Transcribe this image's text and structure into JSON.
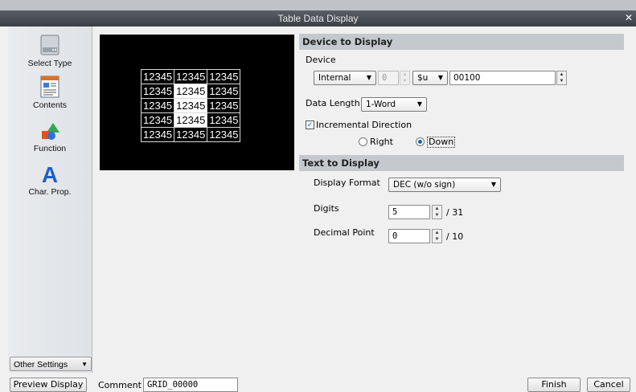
{
  "window": {
    "title": "Table Data Display"
  },
  "sidebar": {
    "items": [
      {
        "label": "Select Type",
        "icon": "select-type-icon"
      },
      {
        "label": "Contents",
        "icon": "contents-icon"
      },
      {
        "label": "Function",
        "icon": "function-icon"
      },
      {
        "label": "Char. Prop.",
        "icon": "char-prop-icon"
      }
    ],
    "other_settings": "Other Settings"
  },
  "preview": {
    "rows": [
      [
        "12345",
        "12345",
        "12345"
      ],
      [
        "12345",
        "12345",
        "12345"
      ],
      [
        "12345",
        "12345",
        "12345"
      ],
      [
        "12345",
        "12345",
        "12345"
      ],
      [
        "12345",
        "12345",
        "12345"
      ]
    ]
  },
  "device_section": {
    "header": "Device to Display",
    "device_label": "Device",
    "device_type": "Internal",
    "device_number": "0",
    "device_prefix": "$u",
    "device_address": "00100",
    "data_length_label": "Data Length",
    "data_length": "1-Word",
    "incremental_label": "Incremental Direction",
    "incremental_checked": true,
    "direction_right": "Right",
    "direction_down": "Down",
    "direction_selected": "Down"
  },
  "text_section": {
    "header": "Text to Display",
    "display_format_label": "Display Format",
    "display_format": "DEC (w/o sign)",
    "digits_label": "Digits",
    "digits_value": "5",
    "digits_max": "/ 31",
    "decimal_label": "Decimal Point",
    "decimal_value": "0",
    "decimal_max": "/ 10"
  },
  "bottom": {
    "preview_button": "Preview Display",
    "comment_label": "Comment",
    "comment_value": "GRID_00000",
    "finish_button": "Finish",
    "cancel_button": "Cancel"
  }
}
